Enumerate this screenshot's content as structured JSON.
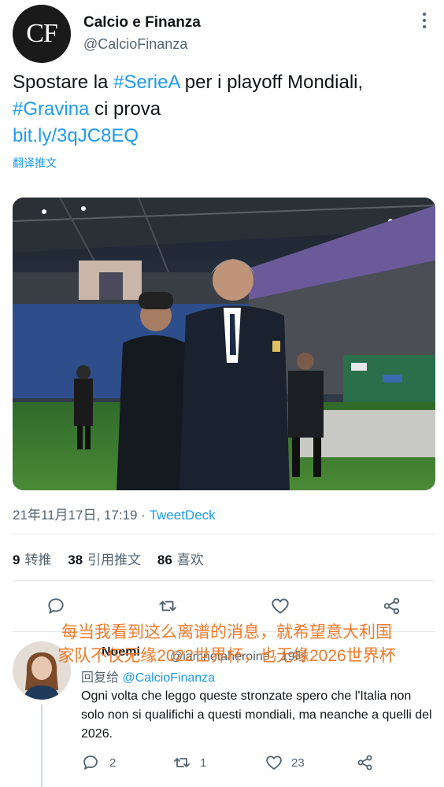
{
  "tweet": {
    "avatar_text": "CF",
    "author_name": "Calcio e Finanza",
    "author_handle": "@CalcioFinanza",
    "text_part1": "Spostare la ",
    "hashtag1": "#SerieA",
    "text_part2": " per i playoff Mondiali,",
    "hashtag2": "#Gravina",
    "text_part3": " ci prova",
    "link": "bit.ly/3qJC8EQ",
    "translate_label": "翻译推文",
    "date_time": "21年11月17日, 17:19 · ",
    "source": "TweetDeck"
  },
  "stats": {
    "retweets_count": "9",
    "retweets_label": "转推",
    "quotes_count": "38",
    "quotes_label": "引用推文",
    "likes_count": "86",
    "likes_label": "喜欢"
  },
  "overlay_caption": {
    "line1": "每当我看到这么离谱的消息，就希望意大利国",
    "line2": "家队不仅无缘2022世界杯，也无缘2026世界杯"
  },
  "reply": {
    "author_name": "Noemi",
    "author_handle": "@iamnotaheroine · 19时",
    "reply_to_label": "回复给 ",
    "reply_to_handle": "@CalcioFinanza",
    "text": "Ogni volta che leggo queste stronzate spero che l'Italia non solo non si qualifichi a questi mondiali, ma neanche a quelli del 2026.",
    "reply_count": "2",
    "retweet_count": "1",
    "like_count": "23"
  },
  "colors": {
    "accent": "#1d9bf0",
    "secondary_text": "#536471",
    "overlay": "#f07a2a"
  }
}
